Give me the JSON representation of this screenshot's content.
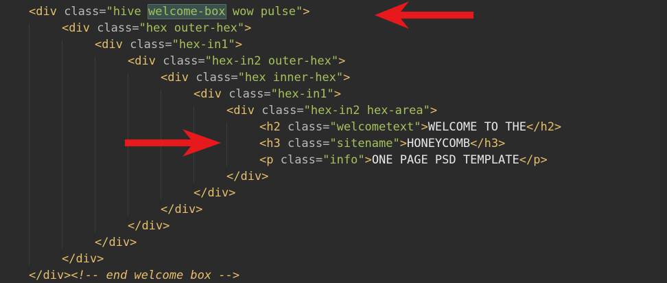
{
  "code": {
    "line1": {
      "open": "<div ",
      "attr": "class=",
      "q1": "\"hive ",
      "hl": "welcome-box",
      "q2": " wow pulse\"",
      "close": ">"
    },
    "line2": {
      "open": "<div ",
      "attr": "class=",
      "val": "\"hex outer-hex\"",
      "close": ">"
    },
    "line3": {
      "open": "<div ",
      "attr": "class=",
      "val": "\"hex-in1\"",
      "close": ">"
    },
    "line4": {
      "open": "<div ",
      "attr": "class=",
      "val": "\"hex-in2 outer-hex\"",
      "close": ">"
    },
    "line5": {
      "open": "<div ",
      "attr": "class=",
      "val": "\"hex inner-hex\"",
      "close": ">"
    },
    "line6": {
      "open": "<div ",
      "attr": "class=",
      "val": "\"hex-in1\"",
      "close": ">"
    },
    "line7": {
      "open": "<div ",
      "attr": "class=",
      "val": "\"hex-in2 hex-area\"",
      "close": ">"
    },
    "line8": {
      "open": "<h2 ",
      "attr": "class=",
      "val": "\"welcometext\"",
      "close": ">",
      "text": "WELCOME TO THE",
      "end": "</h2>"
    },
    "line9": {
      "open": "<h3 ",
      "attr": "class=",
      "val": "\"sitename\"",
      "close": ">",
      "text": "HONEYCOMB",
      "end": "</h3>"
    },
    "line10": {
      "open": "<p ",
      "attr": "class=",
      "val": "\"info\"",
      "close": ">",
      "text": "ONE PAGE PSD TEMPLATE",
      "end": "</p>"
    },
    "line11": {
      "end": "</div>"
    },
    "line12": {
      "end": "</div>"
    },
    "line13": {
      "end": "</div>"
    },
    "line14": {
      "end": "</div>"
    },
    "line15": {
      "end": "</div>"
    },
    "line16": {
      "end": "</div>"
    },
    "line17": {
      "end": "</div>",
      "comment": "<!-- end welcome box -->"
    }
  },
  "colors": {
    "background": "#2b2b2b",
    "tag": "#e8bf6a",
    "attribute": "#bababa",
    "string": "#a5c25c",
    "text": "#e8e8e8",
    "highlight": "#3b514d",
    "arrow": "#e8191c"
  },
  "icons": [
    "arrow-left-icon",
    "arrow-right-icon"
  ]
}
